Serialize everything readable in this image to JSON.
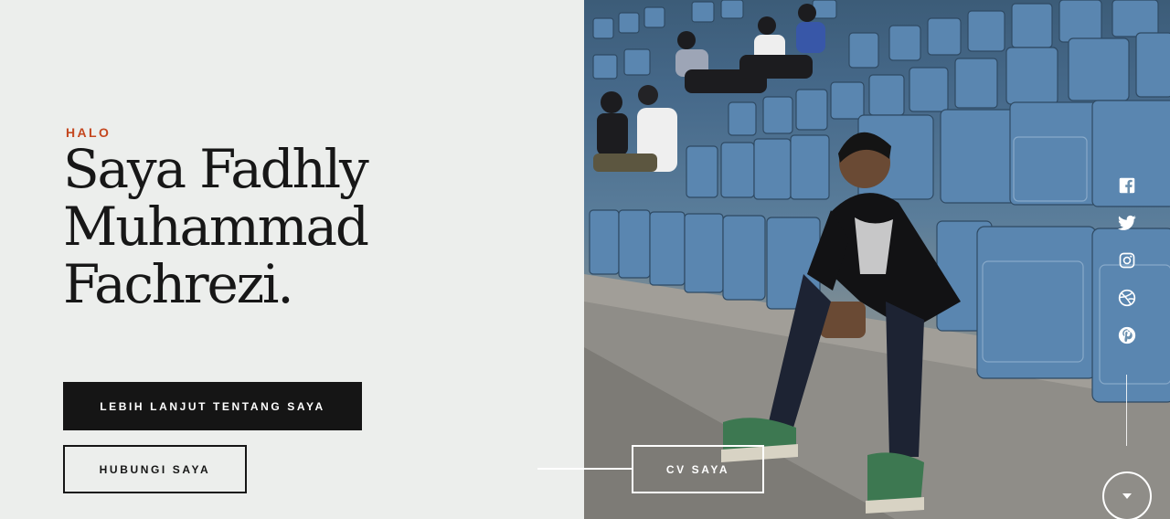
{
  "hero": {
    "eyebrow": "HALO",
    "headline": [
      "Saya Fadhly",
      "Muhammad",
      "Fachrezi."
    ]
  },
  "buttons": {
    "about": "LEBIH LANJUT TENTANG SAYA",
    "contact": "HUBUNGI SAYA",
    "cv": "CV SAYA"
  },
  "social": [
    "facebook-icon",
    "twitter-icon",
    "instagram-icon",
    "dribbble-icon",
    "pinterest-icon"
  ],
  "scroll": {
    "icon": "caret-down-icon"
  },
  "colors": {
    "accent": "#c4471f",
    "dark": "#151515",
    "background": "#eceeec",
    "seat_blue": "#5d8bb5"
  }
}
